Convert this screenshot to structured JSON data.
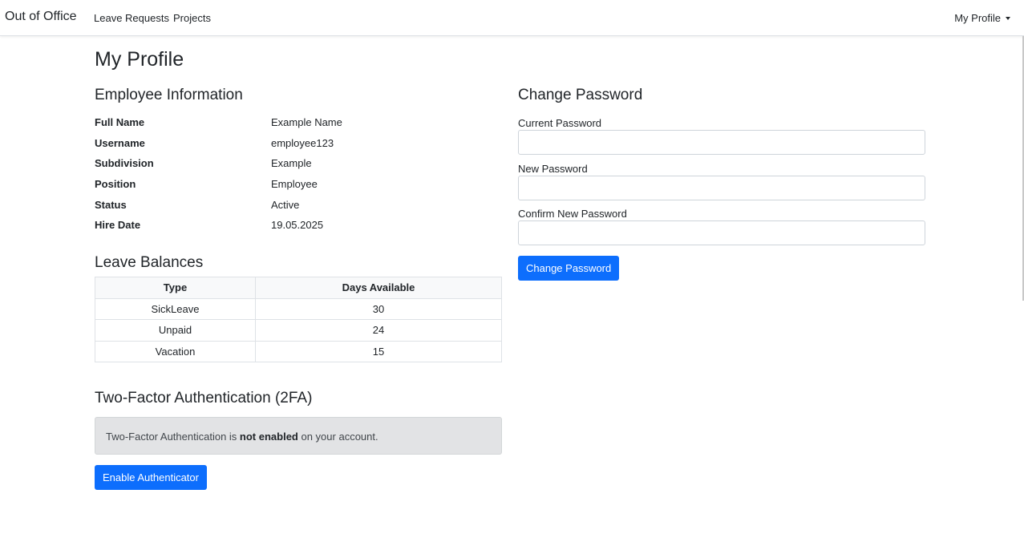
{
  "navbar": {
    "brand": "Out of Office",
    "links": [
      "Leave Requests",
      "Projects"
    ],
    "profile_menu": "My Profile"
  },
  "page": {
    "title": "My Profile"
  },
  "employee": {
    "heading": "Employee Information",
    "fields": [
      {
        "label": "Full Name",
        "value": "Example Name"
      },
      {
        "label": "Username",
        "value": "employee123"
      },
      {
        "label": "Subdivision",
        "value": "Example"
      },
      {
        "label": "Position",
        "value": "Employee"
      },
      {
        "label": "Status",
        "value": "Active"
      },
      {
        "label": "Hire Date",
        "value": "19.05.2025"
      }
    ]
  },
  "leave_balances": {
    "heading": "Leave Balances",
    "columns": [
      "Type",
      "Days Available"
    ],
    "rows": [
      [
        "SickLeave",
        "30"
      ],
      [
        "Unpaid",
        "24"
      ],
      [
        "Vacation",
        "15"
      ]
    ]
  },
  "two_factor": {
    "heading": "Two-Factor Authentication (2FA)",
    "alert_prefix": "Two-Factor Authentication is ",
    "alert_bold": "not enabled",
    "alert_suffix": " on your account.",
    "button": "Enable Authenticator"
  },
  "change_password": {
    "heading": "Change Password",
    "current_label": "Current Password",
    "current_value": "",
    "new_label": "New Password",
    "new_value": "",
    "confirm_label": "Confirm New Password",
    "confirm_value": "",
    "button": "Change Password"
  },
  "colors": {
    "primary": "#0d6efd",
    "alert_bg": "#e2e3e5",
    "border": "#dee2e6"
  }
}
